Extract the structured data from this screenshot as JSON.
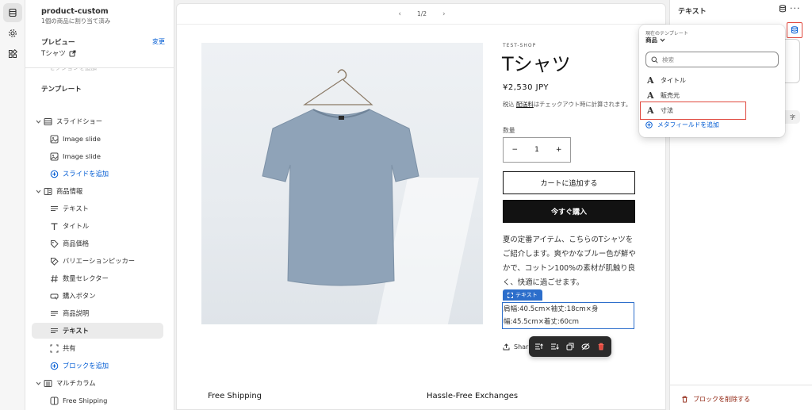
{
  "rail": {
    "items": [
      {
        "name": "sections-icon",
        "active": true
      },
      {
        "name": "settings-icon",
        "active": false
      },
      {
        "name": "apps-icon",
        "active": false
      }
    ]
  },
  "left_panel": {
    "template_name": "product-custom",
    "template_sub": "1個の商品に割り当て済み",
    "preview_label": "プレビュー",
    "preview_change": "変更",
    "preview_value": "Tシャツ",
    "cut_off_row": "セクションを追加",
    "section_label": "テンプレート",
    "tree": [
      {
        "label": "スライドショー",
        "level": 0,
        "icon": "slideshow-icon",
        "chevron": true
      },
      {
        "label": "Image slide",
        "level": 1,
        "icon": "image-icon"
      },
      {
        "label": "Image slide",
        "level": 1,
        "icon": "image-icon"
      },
      {
        "label": "スライドを追加",
        "level": 1,
        "icon": "add-circle-icon",
        "add": true
      },
      {
        "label": "商品情報",
        "level": 0,
        "icon": "product-info-icon",
        "chevron": true
      },
      {
        "label": "テキスト",
        "level": 1,
        "icon": "text-lines-icon"
      },
      {
        "label": "タイトル",
        "level": 1,
        "icon": "title-t-icon"
      },
      {
        "label": "商品価格",
        "level": 1,
        "icon": "price-tag-icon"
      },
      {
        "label": "バリエーションピッカー",
        "level": 1,
        "icon": "variant-picker-icon"
      },
      {
        "label": "数量セレクター",
        "level": 1,
        "icon": "hash-icon"
      },
      {
        "label": "購入ボタン",
        "level": 1,
        "icon": "buy-button-icon"
      },
      {
        "label": "商品説明",
        "level": 1,
        "icon": "text-lines-icon"
      },
      {
        "label": "テキスト",
        "level": 1,
        "icon": "text-lines-icon",
        "selected": true
      },
      {
        "label": "共有",
        "level": 1,
        "icon": "share-frame-icon"
      },
      {
        "label": "ブロックを追加",
        "level": 1,
        "icon": "add-circle-icon",
        "add": true
      },
      {
        "label": "マルチカラム",
        "level": 0,
        "icon": "multicolumn-icon",
        "chevron": true
      },
      {
        "label": "Free Shipping",
        "level": 1,
        "icon": "column-icon"
      },
      {
        "label": "Hassle-Free Exchanges",
        "level": 1,
        "icon": "column-icon"
      }
    ]
  },
  "preview": {
    "pager": "1/2",
    "vendor": "TEST-SHOP",
    "title": "Tシャツ",
    "price": "¥2,530 JPY",
    "tax_prefix": "税込",
    "tax_link": "配送料",
    "tax_suffix": "はチェックアウト時に計算されます。",
    "qty_label": "数量",
    "qty_value": "1",
    "qty_minus": "−",
    "qty_plus": "+",
    "add_to_cart": "カートに追加する",
    "buy_now": "今すぐ購入",
    "description": "夏の定番アイテム、こちらのTシャツをご紹介します。爽やかなブルー色が鮮やかで、コットン100%の素材が肌触り良く、快適に過ごせます。",
    "text_block_tag": "テキスト",
    "text_block_line1": "肩幅:40.5cm×袖丈:18cm×身",
    "text_block_line2": "幅:45.5cm×着丈:60cm",
    "share": "Shar",
    "feature_1": "Free Shipping",
    "feature_2": "Hassle-Free Exchanges"
  },
  "right_panel": {
    "title": "テキスト",
    "ghost_char": "字",
    "remove_block": "ブロックを削除する"
  },
  "popover": {
    "template_label": "現在のテンプレート",
    "template_value": "商品",
    "search_placeholder": "検索",
    "items": [
      {
        "label": "タイトル",
        "highlighted": false
      },
      {
        "label": "販売元",
        "highlighted": false
      },
      {
        "label": "寸法",
        "highlighted": true
      }
    ],
    "add_metafield": "メタフィールドを追加"
  },
  "colors": {
    "accent_blue": "#005bd3",
    "selection_blue": "#2c6ecb",
    "highlight_red": "#e0483e",
    "danger_text": "#8e1f0b",
    "buy_button": "#121212",
    "tshirt": "#8fa3b8"
  }
}
